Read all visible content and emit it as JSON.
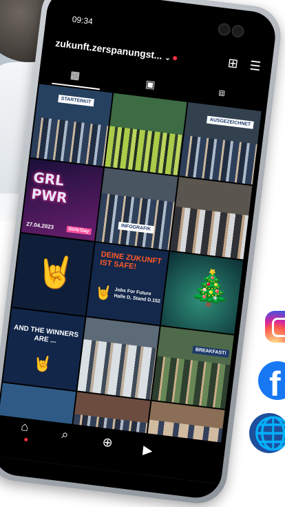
{
  "status_bar": {
    "time": "09:34"
  },
  "header": {
    "account_name": "zukunft.zerspanungst...",
    "chevron_glyph": "⌄",
    "add_glyph": "⊞",
    "menu_glyph": "☰"
  },
  "tabs": [
    {
      "icon": "grid-icon",
      "glyph": "▦"
    },
    {
      "icon": "reels-icon",
      "glyph": "▣"
    },
    {
      "icon": "tagged-icon",
      "glyph": "⧈"
    }
  ],
  "posts": [
    {
      "label": "STARTERKIT",
      "bg": "#26415f"
    },
    {
      "label": "",
      "bg": "#3c6b44"
    },
    {
      "label": "AUSGEZEICHNET",
      "bg": "#33414f"
    },
    {
      "label": "GRL PWR",
      "date": "27.04.2023",
      "tag": "Girls'Day",
      "bg": "#3a1f5c"
    },
    {
      "label": "INFOGRAFIK",
      "bg": "#4a5562"
    },
    {
      "label": "",
      "bg": "#5b5550"
    },
    {
      "label": "",
      "bg": "#0f1f3a"
    },
    {
      "label": "DEINE ZUKUNFT IST SAFE!",
      "sub": "Jobs For Future Halle D, Stand D.152",
      "bg": "#13284a"
    },
    {
      "label": "",
      "bg": "#123f46"
    },
    {
      "label": "AND THE WINNERS ARE ...",
      "bg": "#12264a"
    },
    {
      "label": "",
      "bg": "#5d6a78"
    },
    {
      "label": "BREAKFAST!",
      "bg": "#4f6a4a"
    },
    {
      "label": "",
      "bg": "#2f5a86"
    },
    {
      "label": "",
      "bg": "#6b4c3f"
    },
    {
      "label": "",
      "bg": "#8a6e55"
    }
  ],
  "bottom_nav": [
    {
      "icon": "home-icon",
      "glyph": "⌂"
    },
    {
      "icon": "search-icon",
      "glyph": "⌕"
    },
    {
      "icon": "add-icon",
      "glyph": "⊕"
    },
    {
      "icon": "reels-icon",
      "glyph": "▶"
    }
  ],
  "social": [
    {
      "icon": "instagram-icon"
    },
    {
      "icon": "facebook-icon",
      "glyph": "f"
    },
    {
      "icon": "website-globe-icon",
      "glyph": "🌐"
    }
  ]
}
